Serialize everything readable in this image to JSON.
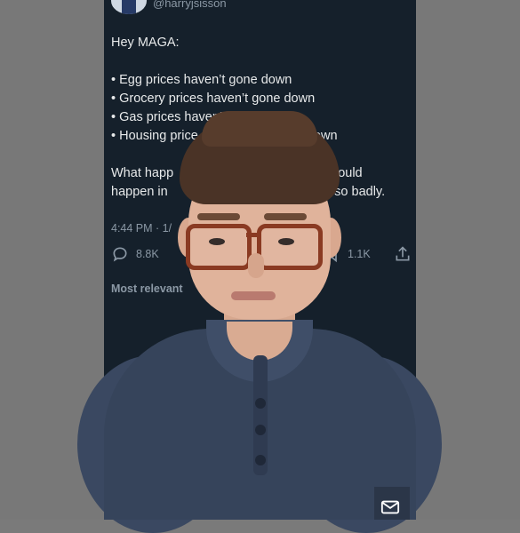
{
  "post": {
    "handle": "@harryjsisson",
    "greeting": "Hey MAGA:",
    "bullets": [
      "• Egg prices haven’t gone down",
      "• Grocery prices haven’t gone down",
      "• Gas prices haven’t gone down",
      "• Housing price",
      "e down"
    ],
    "closing_lines": [
      [
        "What happ",
        "this would"
      ],
      [
        "happen in",
        "ayed so badly."
      ]
    ],
    "meta": "4:44 PM · 1/",
    "replies_count": "8.8K",
    "bookmarks_count": "1.1K",
    "most_relevant": "Most relevant"
  },
  "icons": {
    "reply": "reply-icon",
    "bookmark": "bookmark-icon",
    "share": "share-icon",
    "mail": "mail-icon"
  },
  "colors": {
    "background": "#15202b",
    "text": "#e7e9ea",
    "muted": "#8b98a5",
    "sidebar_gray": "#787878"
  }
}
